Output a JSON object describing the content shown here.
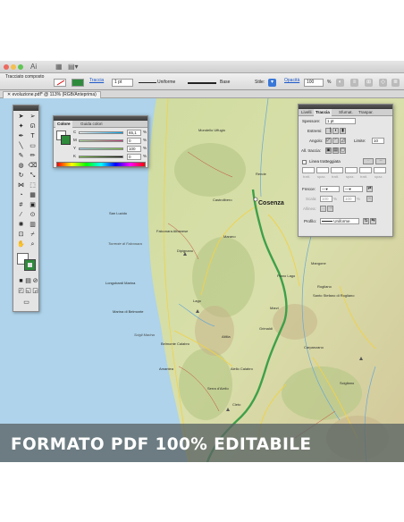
{
  "app": {
    "tool_label": "Tracciato composto",
    "document_tab": "evoluzione.pdf* @ 113% (RGB/Anteprima)"
  },
  "controlbar": {
    "stroke_label": "Traccia",
    "stroke_weight": "1 pt",
    "profile": "Uniforme",
    "brush": "Base",
    "style_label": "Stile:",
    "opacity_label": "Opacità",
    "opacity_value": "100",
    "opacity_unit": "%"
  },
  "color_panel": {
    "tabs": [
      "Colore",
      "Guida colori"
    ],
    "channels": [
      {
        "label": "C",
        "value": "65,1",
        "unit": "%"
      },
      {
        "label": "M",
        "value": "0",
        "unit": "%"
      },
      {
        "label": "Y",
        "value": "100",
        "unit": "%"
      },
      {
        "label": "K",
        "value": "0",
        "unit": "%"
      }
    ]
  },
  "stroke_panel": {
    "tabs": [
      "Livelli",
      "Traccia",
      "Sfumat.",
      "Traspar."
    ],
    "weight_label": "Spessore:",
    "weight_value": "1 pt",
    "caps_label": "Estremi:",
    "corner_label": "Angolo:",
    "limit_label": "Limite:",
    "limit_value": "10",
    "align_label": "All. traccia:",
    "dashed_label": "Linea tratteggiata",
    "dash_labels": [
      "tratt.",
      "spaz.",
      "tratt.",
      "spaz.",
      "tratt.",
      "spaz."
    ],
    "arrowheads_label": "Frecce:",
    "scale_label": "Scala:",
    "scale_values": [
      "100",
      "100"
    ],
    "scale_unit": "%",
    "align_arrows_label": "Allinea:",
    "profile_label": "Profilo:",
    "profile_value": "Uniforme"
  },
  "map": {
    "places": [
      {
        "name": "Mondello Uffugio",
        "style": "small"
      },
      {
        "name": "Rende",
        "style": "small"
      },
      {
        "name": "Castrolibero",
        "style": "small"
      },
      {
        "name": "Cosenza",
        "style": "big"
      },
      {
        "name": "San Lucido",
        "style": "small"
      },
      {
        "name": "Falconara Albanese",
        "style": "small"
      },
      {
        "name": "Torrente di Falconara",
        "style": "italic"
      },
      {
        "name": "Longobardi Marina",
        "style": "small"
      },
      {
        "name": "Marina di Belmonte",
        "style": "small"
      },
      {
        "name": "Scigli Marina",
        "style": "italic"
      },
      {
        "name": "Piano Lago",
        "style": "small"
      },
      {
        "name": "Marano",
        "style": "small"
      },
      {
        "name": "Dipignano",
        "style": "small"
      },
      {
        "name": "Mangone",
        "style": "small"
      },
      {
        "name": "Rogliano",
        "style": "small"
      },
      {
        "name": "Santo Stefano di Rogliano",
        "style": "small"
      },
      {
        "name": "Marzi",
        "style": "small"
      },
      {
        "name": "Altilia",
        "style": "small"
      },
      {
        "name": "Grimaldi",
        "style": "small"
      },
      {
        "name": "Aiello Calabro",
        "style": "small"
      },
      {
        "name": "Serra d'Aiello",
        "style": "small"
      },
      {
        "name": "Amantea",
        "style": "small"
      },
      {
        "name": "Lago",
        "style": "small"
      },
      {
        "name": "Belmonte Calabro",
        "style": "small"
      },
      {
        "name": "Cleto",
        "style": "small"
      },
      {
        "name": "Scigliano",
        "style": "small"
      },
      {
        "name": "Carpanzano",
        "style": "small"
      }
    ]
  },
  "banner": {
    "text": "FORMATO PDF 100% EDITABILE"
  },
  "colors": {
    "sea": "#aed3ea",
    "land": "#d7dfa5",
    "road_main": "#3ea04a",
    "road_secondary": "#f0d24a",
    "banner_bg": "#5f6a6a",
    "accent": "#3a78d8"
  }
}
